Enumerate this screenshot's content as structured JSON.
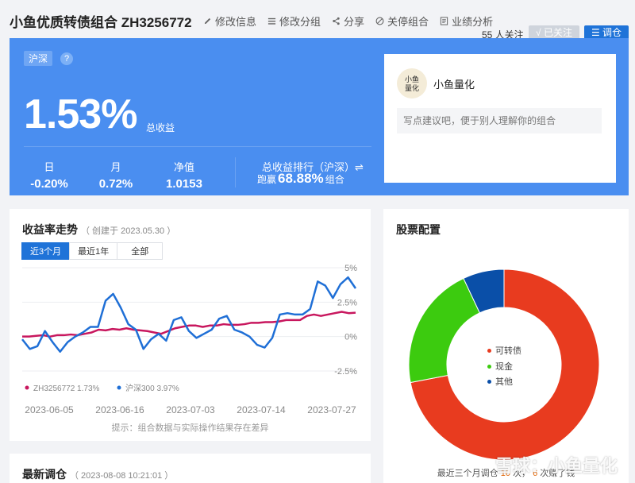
{
  "header": {
    "title": "小鱼优质转债组合 ZH3256772",
    "actions": [
      "修改信息",
      "修改分组",
      "分享",
      "关停组合",
      "业绩分析"
    ],
    "followers": "55 人关注",
    "followed_label": "√ 已关注",
    "rebalance_label": "调仓"
  },
  "summary": {
    "market_badge": "沪深",
    "help": "?",
    "total_return": "1.53%",
    "total_return_label": "总收益",
    "day_label": "日",
    "day_value": "-0.20%",
    "month_label": "月",
    "month_value": "0.72%",
    "nav_label": "净值",
    "nav_value": "1.0153",
    "rank_label": "总收益排行（沪深）⇌",
    "rank_prefix": "跑赢",
    "rank_value": "68.88%",
    "rank_suffix": "组合"
  },
  "manager": {
    "name": "小鱼量化",
    "avatar_text": "小鱼量化",
    "note_placeholder": "写点建议吧，便于别人理解你的组合"
  },
  "trend": {
    "title": "收益率走势",
    "created": "（ 创建于 2023.05.30 ）",
    "tabs": [
      "近3个月",
      "最近1年",
      "全部"
    ],
    "active_tab": 0,
    "hint": "提示：组合数据与实际操作结果存在差异"
  },
  "chart_data": {
    "type": "line",
    "x_ticks": [
      "2023-06-05",
      "2023-06-16",
      "2023-07-03",
      "2023-07-14",
      "2023-07-27"
    ],
    "y_ticks": [
      "5%",
      "2.5%",
      "0%",
      "-2.5%"
    ],
    "ylim": [
      -2.5,
      5
    ],
    "grid": true,
    "legend": "bottom-left",
    "colors": {
      "portfolio": "#c8175e",
      "index": "#1f6fd6"
    },
    "series": [
      {
        "name": "ZH3256772",
        "label": "ZH3256772 1.73%",
        "values": [
          0.0,
          0.0,
          0.05,
          0.1,
          0.0,
          0.1,
          0.1,
          0.15,
          0.1,
          0.2,
          0.3,
          0.5,
          0.45,
          0.55,
          0.5,
          0.6,
          0.5,
          0.45,
          0.4,
          0.3,
          0.2,
          0.4,
          0.6,
          0.7,
          0.8,
          0.8,
          0.7,
          0.8,
          0.8,
          0.9,
          0.85,
          0.85,
          0.9,
          1.0,
          1.0,
          1.05,
          1.05,
          1.1,
          1.2,
          1.2,
          1.2,
          1.5,
          1.6,
          1.5,
          1.6,
          1.7,
          1.8,
          1.7,
          1.73
        ]
      },
      {
        "name": "沪深300",
        "label": "沪深300 3.97%",
        "values": [
          -0.2,
          -0.9,
          -0.7,
          0.4,
          -0.4,
          -1.1,
          -0.4,
          0.0,
          0.3,
          0.7,
          0.7,
          2.6,
          3.1,
          2.1,
          0.9,
          0.5,
          -0.9,
          -0.2,
          0.2,
          -0.3,
          1.2,
          1.4,
          0.4,
          -0.1,
          0.2,
          0.5,
          1.3,
          1.5,
          0.5,
          0.3,
          0.0,
          -0.6,
          -0.8,
          -0.1,
          1.6,
          1.7,
          1.6,
          1.6,
          2.0,
          4.0,
          3.7,
          2.8,
          3.8,
          4.3,
          3.5
        ]
      }
    ]
  },
  "allocation": {
    "title": "股票配置",
    "chart": {
      "type": "pie",
      "slices": [
        {
          "name": "可转债",
          "value": 72.0,
          "color": "#e83b1f"
        },
        {
          "name": "现金",
          "value": 21.0,
          "color": "#3ccb0f"
        },
        {
          "name": "其他",
          "value": 7.0,
          "color": "#0a4fa8"
        }
      ]
    },
    "footer_prefix": "最近三个月调仓",
    "footer_count": "10",
    "footer_mid": "次，",
    "footer_win": "6",
    "footer_suffix": "次赚了钱"
  },
  "latest": {
    "title": "最新调仓",
    "time": "（ 2023-08-08 10:21:01 ）"
  },
  "watermark": "雪球：小鱼量化"
}
